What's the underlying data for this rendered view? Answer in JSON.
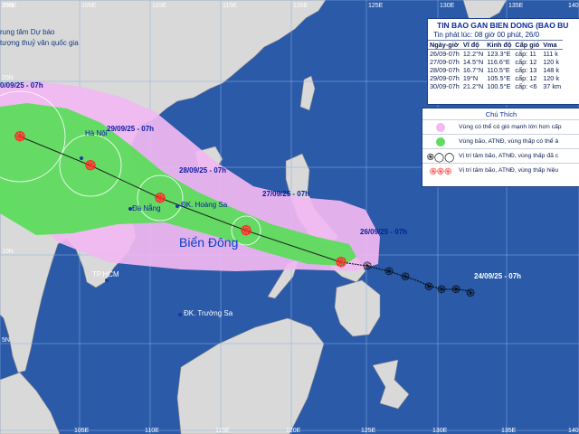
{
  "colors": {
    "sea": "#2a5aa8",
    "land": "#d9d9d9",
    "danger_zone": "#f2b9f2",
    "storm_zone": "#5ddc5d",
    "track": "#ff2a2a",
    "past_track": "#000000",
    "date_label": "#0a1aa0"
  },
  "grid_lon_labels_top": [
    "100E",
    "105E",
    "110E",
    "115E",
    "120E",
    "125E",
    "130E",
    "135E",
    "140"
  ],
  "grid_lon_labels_bottom": [
    "105E",
    "110E",
    "115E",
    "120E",
    "125E",
    "130E",
    "135E",
    "140"
  ],
  "grid_lat_labels": [
    "25N",
    "20N",
    "15N",
    "10N",
    "5N"
  ],
  "places": {
    "hanoi": "Hà Nội",
    "danang": "Đà Nẵng",
    "hoangsa": "ĐK. Hoàng Sa",
    "hcm": "TP.HCM",
    "truongsa": "ĐK. Trường Sa",
    "biendong": "Biển Đông"
  },
  "top_left_note_1": "rung tâm Dự báo",
  "top_left_note_2": "tượng thuỷ văn quốc gia",
  "track_labels": {
    "d30": "0/09/25 - 07h",
    "d29": "29/09/25 - 07h",
    "d28": "28/09/25 - 07h",
    "d27": "27/09/25 - 07h",
    "d26": "26/09/25 - 07h",
    "d24": "24/09/25 - 07h"
  },
  "bulletin": {
    "title": "TIN BAO GAN BIEN DONG (BAO BU",
    "issued": "Tin phát lúc: 08 giờ 00 phút, 26/0",
    "headers": [
      "Ngày-giờ",
      "Vĩ độ",
      "Kinh độ",
      "Cấp gió",
      "Vma"
    ],
    "rows": [
      [
        "26/09-07h",
        "12.2°N",
        "123.3°E",
        "cấp: 11",
        "111 k"
      ],
      [
        "27/09-07h",
        "14.5°N",
        "116.6°E",
        "cấp: 12",
        "120 k"
      ],
      [
        "28/09-07h",
        "16.7°N",
        "110.5°E",
        "cấp: 13",
        "148 k"
      ],
      [
        "29/09-07h",
        "19°N",
        "105.5°E",
        "cấp: 12",
        "120 k"
      ],
      [
        "30/09-07h",
        "21.2°N",
        "100.5°E",
        "cấp: <6",
        "37 km"
      ]
    ]
  },
  "legend": {
    "title": "Chú Thích",
    "items": [
      "Vùng có thể có gió mạnh lớn hơn cấp",
      "Vùng bão, ATNĐ, vùng thấp có thể ả",
      "Vị trí tâm bão, ATNĐ, vùng thấp đã c",
      "Vị trí tâm bão, ATNĐ, vùng thấp hiệu"
    ]
  },
  "track_points": [
    {
      "date": "30/09",
      "lat": 21.2,
      "lon": 100.5
    },
    {
      "date": "29/09",
      "lat": 19.0,
      "lon": 105.5
    },
    {
      "date": "28/09",
      "lat": 16.7,
      "lon": 110.5
    },
    {
      "date": "27/09",
      "lat": 14.5,
      "lon": 116.6
    },
    {
      "date": "26/09",
      "lat": 12.2,
      "lon": 123.3
    }
  ]
}
